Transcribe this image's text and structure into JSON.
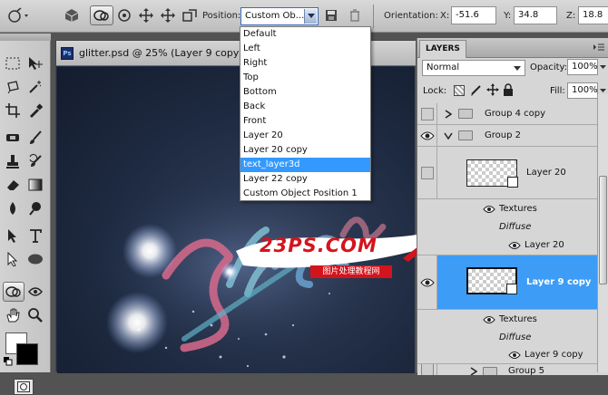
{
  "options_bar": {
    "position_label": "Position:",
    "position_value": "Custom Ob...",
    "orientation_label": "Orientation:",
    "x_label": "X:",
    "x_value": "-51.6",
    "y_label": "Y:",
    "y_value": "34.8",
    "z_label": "Z:",
    "z_value": "18.8"
  },
  "document": {
    "tab_title": "glitter.psd @ 25% (Layer 9 copy, RG",
    "ps_badge": "Ps"
  },
  "position_menu": {
    "items": [
      "Default",
      "Left",
      "Right",
      "Top",
      "Bottom",
      "Back",
      "Front",
      "Layer 20",
      "Layer 20 copy",
      "text_layer3d",
      "Layer 22 copy",
      "Custom Object Position 1"
    ],
    "highlighted": "text_layer3d"
  },
  "layers_panel": {
    "title": "LAYERS",
    "blend_mode": "Normal",
    "opacity_label": "Opacity:",
    "opacity_value": "100%",
    "lock_label": "Lock:",
    "fill_label": "Fill:",
    "fill_value": "100%",
    "rows": {
      "group4": "Group 4 copy",
      "group2": "Group 2",
      "layer20": "Layer 20",
      "textures1": "Textures",
      "diffuse1": "Diffuse",
      "layer20_sub": "Layer 20",
      "layer9": "Layer 9 copy",
      "textures2": "Textures",
      "diffuse2": "Diffuse",
      "layer9_sub": "Layer 9 copy",
      "group5": "Group 5"
    }
  },
  "watermark": {
    "logo": "23PS.COM",
    "subtitle": "图片处理教程网"
  },
  "colors": {
    "selection": "#3399ff",
    "layer_selected": "#3d9cf5",
    "canvas_bg": "#1f2b42",
    "watermark_red": "#d4141c"
  }
}
